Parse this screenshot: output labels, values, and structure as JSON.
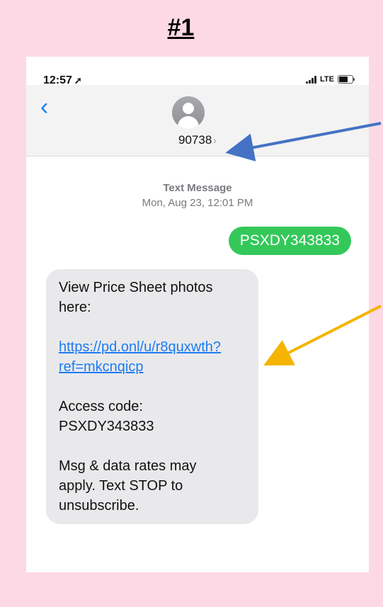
{
  "frame_title": "#1",
  "status_bar": {
    "time": "12:57",
    "location_icon": "location-arrow-icon",
    "network": "LTE"
  },
  "header": {
    "back_icon": "chevron-left-icon",
    "avatar_icon": "person-avatar-icon",
    "contact": "90738",
    "chevron": "›"
  },
  "conversation": {
    "meta_type": "Text Message",
    "meta_date": "Mon, Aug 23, 12:01 PM",
    "sent_message": "PSXDY343833",
    "received": {
      "line1": "View Price Sheet photos",
      "line2": "here:",
      "link_line1": "https://pd.onl/u/r8quxwth?",
      "link_line2": "ref=mkcnqicp",
      "access_line1": "Access code:",
      "access_line2": "PSXDY343833",
      "rates_line1": "Msg & data rates may",
      "rates_line2": "apply. Text STOP to",
      "rates_line3": "unsubscribe."
    }
  },
  "annotations": {
    "arrow_sender_color": "#4472c4",
    "arrow_link_color": "#f5b400"
  }
}
